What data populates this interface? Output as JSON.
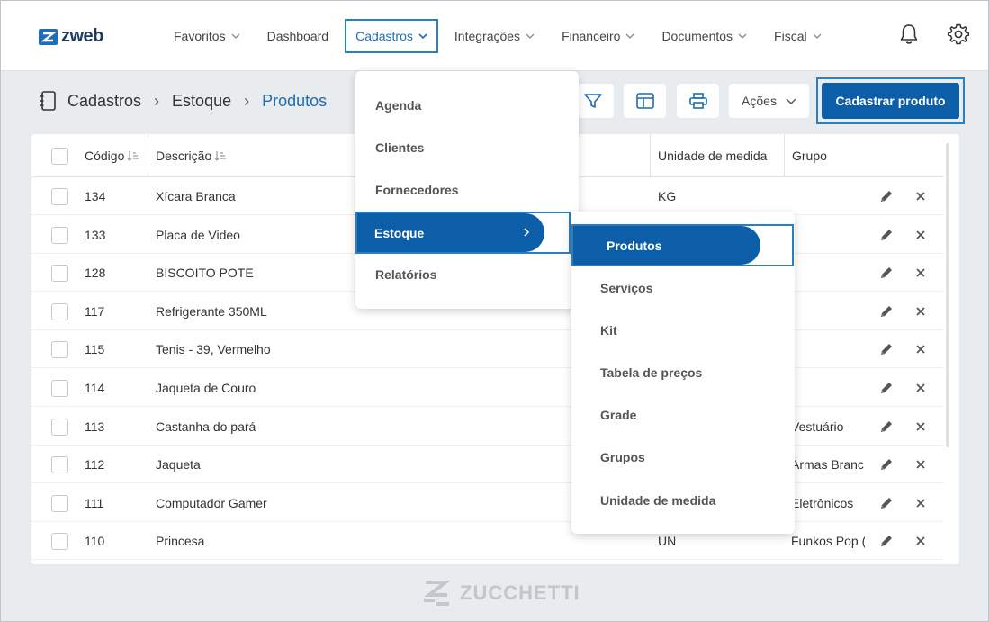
{
  "brand": {
    "name": "zweb",
    "footer": "ZUCCHETTI"
  },
  "nav": [
    {
      "label": "Favoritos",
      "dropdown": true
    },
    {
      "label": "Dashboard",
      "dropdown": false
    },
    {
      "label": "Cadastros",
      "dropdown": true,
      "active": true
    },
    {
      "label": "Integrações",
      "dropdown": true
    },
    {
      "label": "Financeiro",
      "dropdown": true
    },
    {
      "label": "Documentos",
      "dropdown": true
    },
    {
      "label": "Fiscal",
      "dropdown": true
    }
  ],
  "breadcrumb": {
    "level1": "Cadastros",
    "level2": "Estoque",
    "current": "Produtos"
  },
  "toolbar": {
    "actions_label": "Ações",
    "primary_label": "Cadastrar produto"
  },
  "table": {
    "headers": {
      "code": "Código",
      "description": "Descrição",
      "unit": "Unidade de medida",
      "group": "Grupo"
    },
    "rows": [
      {
        "code": "134",
        "description": "Xícara Branca",
        "unit": "KG",
        "group": ""
      },
      {
        "code": "133",
        "description": "Placa de Video",
        "unit": "",
        "group": ""
      },
      {
        "code": "128",
        "description": "BISCOITO POTE",
        "unit": "",
        "group": ""
      },
      {
        "code": "117",
        "description": "Refrigerante 350ML",
        "unit": "",
        "group": ""
      },
      {
        "code": "115",
        "description": "Tenis - 39, Vermelho",
        "unit": "",
        "group": ""
      },
      {
        "code": "114",
        "description": "Jaqueta de Couro",
        "unit": "",
        "group": ""
      },
      {
        "code": "113",
        "description": "Castanha do pará",
        "unit": "",
        "group": "Vestuário"
      },
      {
        "code": "112",
        "description": "Jaqueta",
        "unit": "",
        "group": "Armas Branc"
      },
      {
        "code": "111",
        "description": "Computador Gamer",
        "unit": "",
        "group": "Eletrônicos"
      },
      {
        "code": "110",
        "description": "Princesa",
        "unit": "UN",
        "group": "Funkos Pop ("
      }
    ]
  },
  "menu_cadastros": [
    "Agenda",
    "Clientes",
    "Fornecedores",
    "Estoque",
    "Relatórios"
  ],
  "menu_estoque": [
    "Produtos",
    "Serviços",
    "Kit",
    "Tabela de preços",
    "Grade",
    "Grupos",
    "Unidade de medida"
  ],
  "colors": {
    "primary": "#0d5ea8",
    "highlight": "#2a7fc1",
    "background": "#e9ecee"
  }
}
